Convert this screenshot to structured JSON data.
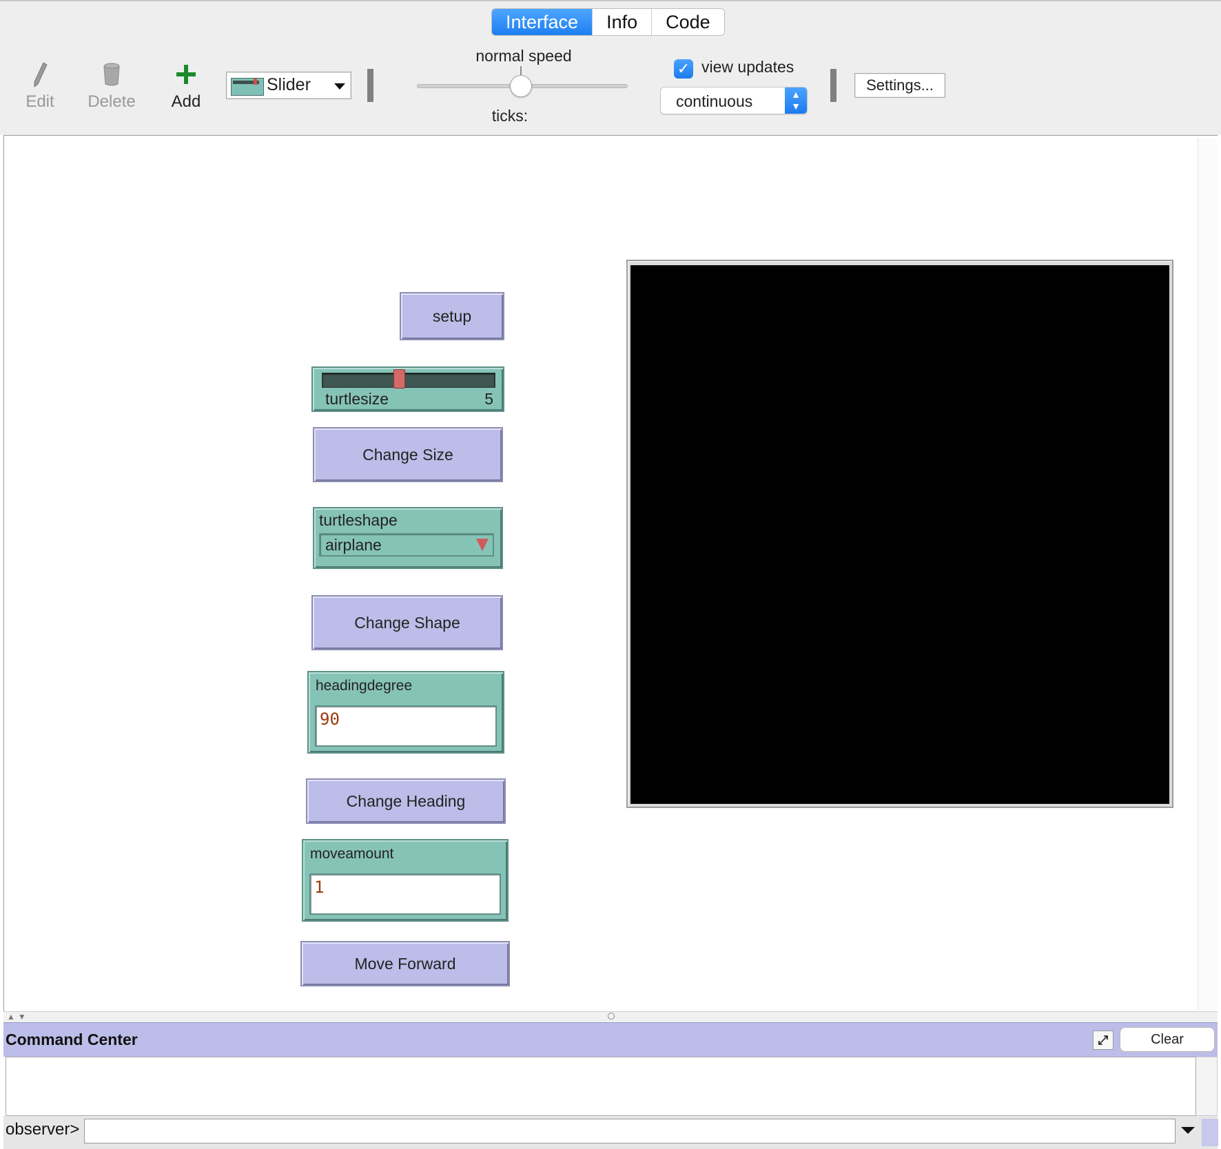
{
  "tabs": [
    "Interface",
    "Info",
    "Code"
  ],
  "active_tab": "Interface",
  "toolbar": {
    "edit_label": "Edit",
    "delete_label": "Delete",
    "add_label": "Add",
    "widget_type": "Slider",
    "speed_label": "normal speed",
    "speed_value": 0.5,
    "ticks_label": "ticks:",
    "view_updates_label": "view updates",
    "view_updates_checked": true,
    "update_mode": "continuous",
    "settings_label": "Settings..."
  },
  "widgets": {
    "setup_label": "setup",
    "slider": {
      "name": "turtlesize",
      "value": "5",
      "position_fraction": 0.42
    },
    "change_size_label": "Change Size",
    "chooser": {
      "name": "turtleshape",
      "value": "airplane"
    },
    "change_shape_label": "Change Shape",
    "heading_input": {
      "name": "headingdegree",
      "value": "90"
    },
    "change_heading_label": "Change Heading",
    "move_input": {
      "name": "moveamount",
      "value": "1"
    },
    "move_forward_label": "Move Forward"
  },
  "command_center": {
    "title": "Command Center",
    "clear_label": "Clear",
    "prompt": "observer>",
    "input_value": ""
  },
  "colors": {
    "button": "#bcbde8",
    "widget": "#86c3b7",
    "world": "#000000",
    "accent": "#1e7ef0",
    "input_value": "#9b3b0f"
  }
}
